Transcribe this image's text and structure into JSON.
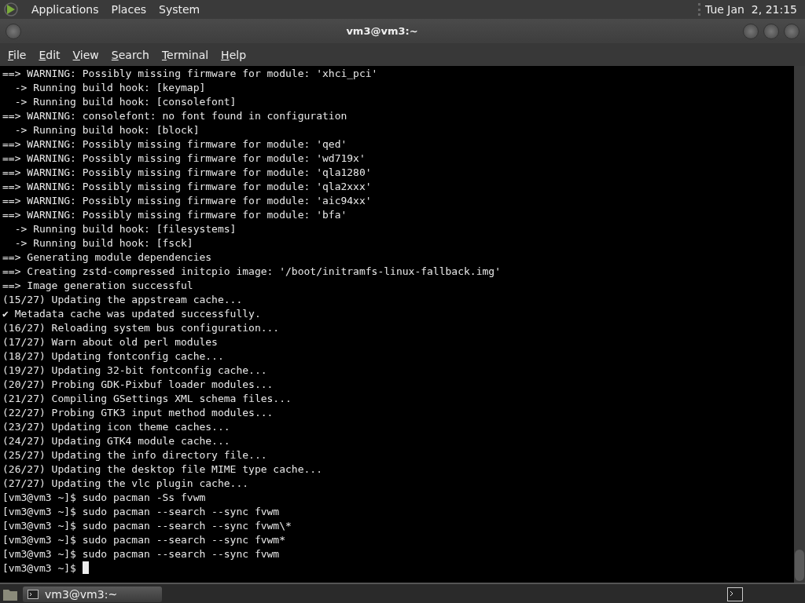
{
  "top_panel": {
    "menus": [
      "Applications",
      "Places",
      "System"
    ],
    "clock": "Tue Jan  2, 21:15"
  },
  "window": {
    "title": "vm3@vm3:~"
  },
  "menubar": [
    "File",
    "Edit",
    "View",
    "Search",
    "Terminal",
    "Help"
  ],
  "terminal": {
    "lines": [
      "==> WARNING: Possibly missing firmware for module: 'xhci_pci'",
      "  -> Running build hook: [keymap]",
      "  -> Running build hook: [consolefont]",
      "==> WARNING: consolefont: no font found in configuration",
      "  -> Running build hook: [block]",
      "==> WARNING: Possibly missing firmware for module: 'qed'",
      "==> WARNING: Possibly missing firmware for module: 'wd719x'",
      "==> WARNING: Possibly missing firmware for module: 'qla1280'",
      "==> WARNING: Possibly missing firmware for module: 'qla2xxx'",
      "==> WARNING: Possibly missing firmware for module: 'aic94xx'",
      "==> WARNING: Possibly missing firmware for module: 'bfa'",
      "  -> Running build hook: [filesystems]",
      "  -> Running build hook: [fsck]",
      "==> Generating module dependencies",
      "==> Creating zstd-compressed initcpio image: '/boot/initramfs-linux-fallback.img'",
      "==> Image generation successful",
      "(15/27) Updating the appstream cache...",
      "✔ Metadata cache was updated successfully.",
      "(16/27) Reloading system bus configuration...",
      "(17/27) Warn about old perl modules",
      "(18/27) Updating fontconfig cache...",
      "(19/27) Updating 32-bit fontconfig cache...",
      "(20/27) Probing GDK-Pixbuf loader modules...",
      "(21/27) Compiling GSettings XML schema files...",
      "(22/27) Probing GTK3 input method modules...",
      "(23/27) Updating icon theme caches...",
      "(24/27) Updating GTK4 module cache...",
      "(25/27) Updating the info directory file...",
      "(26/27) Updating the desktop file MIME type cache...",
      "(27/27) Updating the vlc plugin cache...",
      "[vm3@vm3 ~]$ sudo pacman -Ss fvwm",
      "[vm3@vm3 ~]$ sudo pacman --search --sync fvwm",
      "[vm3@vm3 ~]$ sudo pacman --search --sync fvwm\\*",
      "[vm3@vm3 ~]$ sudo pacman --search --sync fvwm*",
      "[vm3@vm3 ~]$ sudo pacman --search --sync fvwm",
      "[vm3@vm3 ~]$ "
    ]
  },
  "taskbar": {
    "tasks": [
      {
        "label": "vm3@vm3:~",
        "selected": true
      }
    ]
  }
}
